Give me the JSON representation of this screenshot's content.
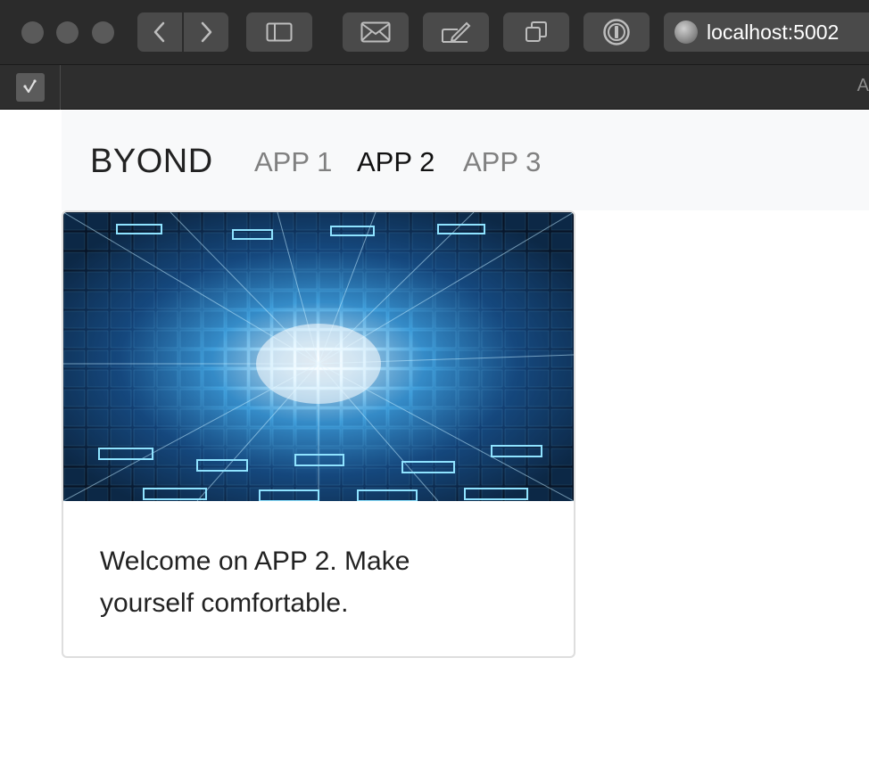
{
  "browser": {
    "url": "localhost:5002",
    "tab_overflow_glyph": "A",
    "icons": [
      "back-icon",
      "forward-icon",
      "sidebar-icon",
      "mail-icon",
      "compose-icon",
      "tabs-icon",
      "password-manager-icon",
      "globe-icon",
      "site-favicon"
    ]
  },
  "navbar": {
    "brand": "BYOND",
    "links": [
      {
        "label": "APP 1",
        "active": false
      },
      {
        "label": "APP 2",
        "active": true
      },
      {
        "label": "APP 3",
        "active": false
      }
    ]
  },
  "card": {
    "image_alt": "technology-media-wall",
    "text": "Welcome on APP 2. Make yourself comfortable."
  },
  "colors": {
    "chrome": "#2b2b2b",
    "navbar_bg": "#f8f9fa",
    "nav_active": "#111111",
    "nav_inactive": "#808080",
    "image_accent": "#3fb8ff"
  }
}
